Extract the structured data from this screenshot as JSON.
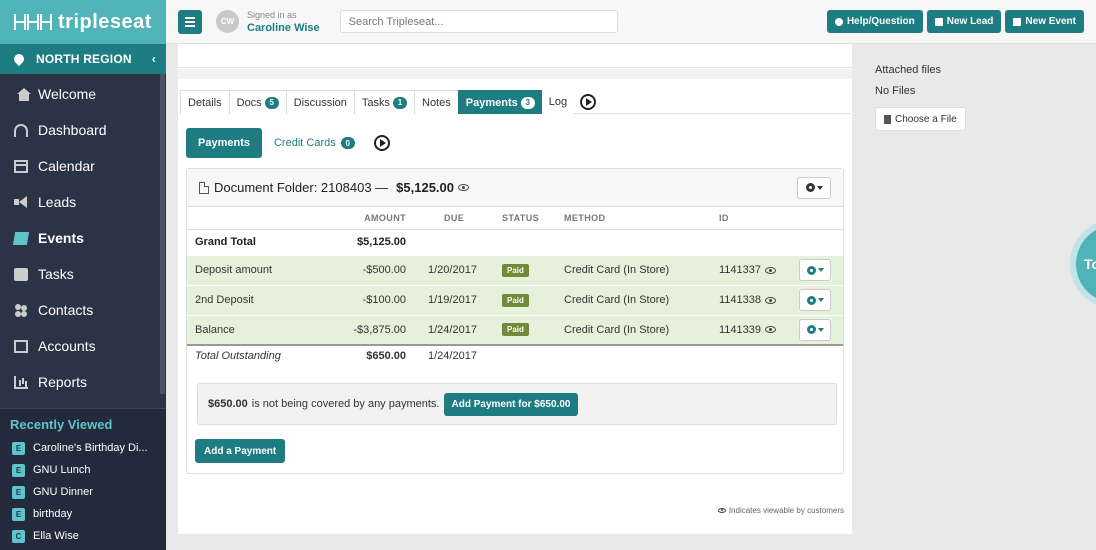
{
  "brand": {
    "name": "tripleseat"
  },
  "sidebar": {
    "region": "NORTH REGION",
    "items": [
      {
        "label": "Welcome",
        "icon": "home-icon"
      },
      {
        "label": "Dashboard",
        "icon": "dashboard-icon"
      },
      {
        "label": "Calendar",
        "icon": "calendar-icon"
      },
      {
        "label": "Leads",
        "icon": "megaphone-icon"
      },
      {
        "label": "Events",
        "icon": "book-icon"
      },
      {
        "label": "Tasks",
        "icon": "checkbox-icon"
      },
      {
        "label": "Contacts",
        "icon": "users-icon"
      },
      {
        "label": "Accounts",
        "icon": "building-icon"
      },
      {
        "label": "Reports",
        "icon": "bar-chart-icon"
      }
    ],
    "recent_title": "Recently Viewed",
    "recent": [
      {
        "tag": "E",
        "label": "Caroline's Birthday Di..."
      },
      {
        "tag": "E",
        "label": "GNU Lunch"
      },
      {
        "tag": "E",
        "label": "GNU Dinner"
      },
      {
        "tag": "E",
        "label": "birthday"
      },
      {
        "tag": "C",
        "label": "Ella Wise"
      }
    ]
  },
  "topbar": {
    "avatar_initials": "CW",
    "signed_in_label": "Signed in as",
    "user_name": "Caroline Wise",
    "search_placeholder": "Search Tripleseat...",
    "help_label": "Help/Question",
    "new_lead_label": "New Lead",
    "new_event_label": "New Event"
  },
  "tabs": [
    {
      "label": "Details",
      "badge": ""
    },
    {
      "label": "Docs",
      "badge": "5"
    },
    {
      "label": "Discussion",
      "badge": ""
    },
    {
      "label": "Tasks",
      "badge": "1"
    },
    {
      "label": "Notes",
      "badge": ""
    },
    {
      "label": "Payments",
      "badge": "3"
    },
    {
      "label": "Log",
      "badge": ""
    }
  ],
  "subtabs": {
    "payments": "Payments",
    "credit_cards": "Credit Cards",
    "credit_cards_badge": "0"
  },
  "panel": {
    "label": "Document Folder: 2108403 —",
    "amount": "$5,125.00",
    "columns": [
      "AMOUNT",
      "DUE",
      "STATUS",
      "METHOD",
      "ID"
    ],
    "grand_total_label": "Grand Total",
    "grand_total_amount": "$5,125.00",
    "rows": [
      {
        "name": "Deposit amount",
        "amount": "-$500.00",
        "due": "1/20/2017",
        "status": "Paid",
        "method": "Credit Card (In Store)",
        "id": "1141337"
      },
      {
        "name": "2nd Deposit",
        "amount": "-$100.00",
        "due": "1/19/2017",
        "status": "Paid",
        "method": "Credit Card (In Store)",
        "id": "1141338"
      },
      {
        "name": "Balance",
        "amount": "-$3,875.00",
        "due": "1/24/2017",
        "status": "Paid",
        "method": "Credit Card (In Store)",
        "id": "1141339"
      }
    ],
    "outstanding_label": "Total Outstanding",
    "outstanding_amount": "$650.00",
    "outstanding_due": "1/24/2017",
    "notice_amount": "$650.00",
    "notice_text": "is not being covered by any payments.",
    "notice_button": "Add Payment for $650.00",
    "add_payment_label": "Add a Payment"
  },
  "footnote": "Indicates viewable by customers",
  "right_panel": {
    "heading": "Attached files",
    "no_files": "No Files",
    "choose_label": "Choose a File",
    "bubble_text": "To"
  },
  "colors": {
    "accent": "#1d7d83",
    "brand": "#4fb3b8",
    "sidebar": "#2b3346",
    "paid": "#6f8a38"
  }
}
